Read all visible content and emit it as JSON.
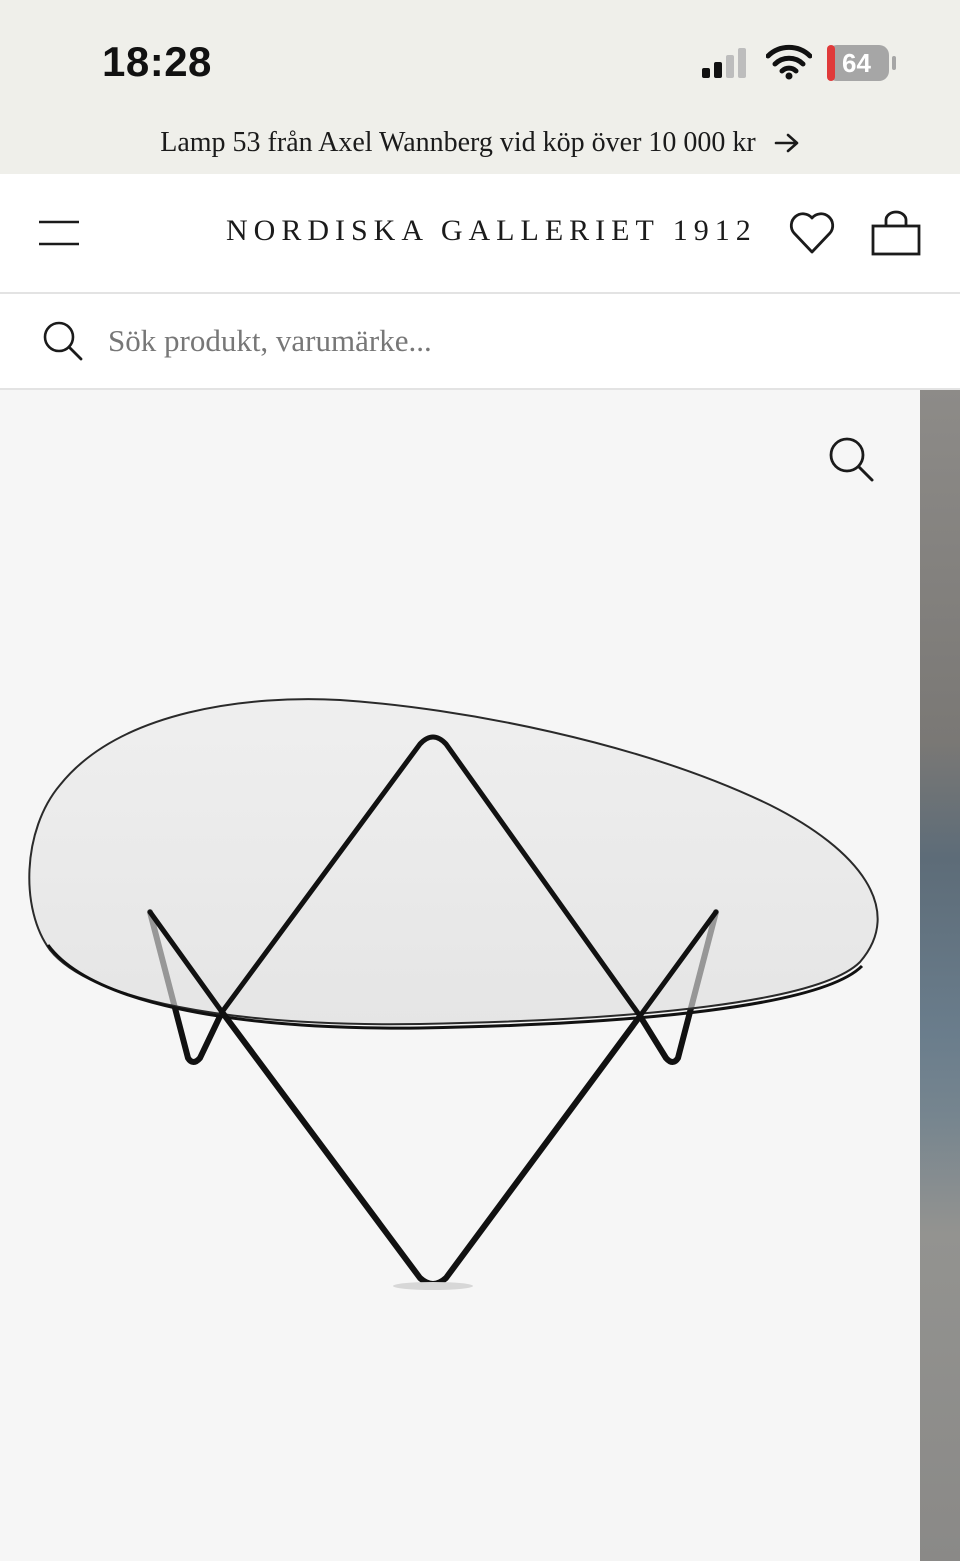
{
  "status_bar": {
    "time": "18:28",
    "battery_level": "64",
    "icons": [
      "signal-icon",
      "wifi-icon",
      "battery-charging-icon"
    ]
  },
  "promo": {
    "text": "Lamp 53 från Axel Wannberg vid köp över 10 000 kr",
    "icon": "arrow-right-icon"
  },
  "header": {
    "logo": "NORDISKA GALLERIET 1912",
    "icons": [
      "menu-icon",
      "heart-icon",
      "bag-icon"
    ]
  },
  "search": {
    "placeholder": "Sök produkt, varumärke...",
    "value": ""
  },
  "gallery": {
    "images": [
      "glass-coffee-table-wire-base",
      "interior-photo-partial"
    ],
    "current_index": 0,
    "zoom_icon": "zoom-icon"
  },
  "colors": {
    "top_bar_bg": "#efefea",
    "header_bg": "#ffffff",
    "image_bg": "#f6f6f6",
    "text": "#1b1b1b",
    "battery_red": "#e03a3a"
  }
}
